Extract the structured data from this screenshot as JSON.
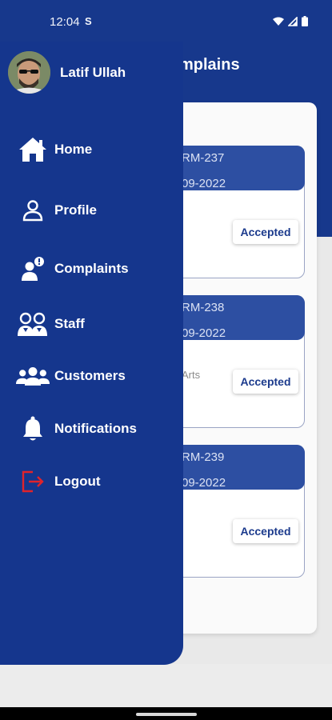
{
  "status_bar": {
    "time": "12:04",
    "sim_icon": "sim-s-icon"
  },
  "header": {
    "title": "mplains"
  },
  "cards": [
    {
      "code": "RM-237",
      "date": "09-2022",
      "extra": "",
      "status": "Accepted"
    },
    {
      "code": "RM-238",
      "date": "09-2022",
      "extra": "Arts",
      "status": "Accepted"
    },
    {
      "code": "RM-239",
      "date": "09-2022",
      "extra": "",
      "status": "Accepted"
    }
  ],
  "drawer": {
    "user_name": "Latif Ullah",
    "items": [
      {
        "label": "Home",
        "icon": "home-icon"
      },
      {
        "label": "Profile",
        "icon": "person-icon"
      },
      {
        "label": "Complaints",
        "icon": "complaint-icon"
      },
      {
        "label": "Staff",
        "icon": "staff-icon"
      },
      {
        "label": "Customers",
        "icon": "customers-icon"
      },
      {
        "label": "Notifications",
        "icon": "bell-icon"
      },
      {
        "label": "Logout",
        "icon": "logout-icon"
      }
    ]
  },
  "colors": {
    "primary": "#15368d",
    "card_header": "#2d4fa2",
    "logout": "#e0232b",
    "status_text": "#1c3b8d"
  }
}
